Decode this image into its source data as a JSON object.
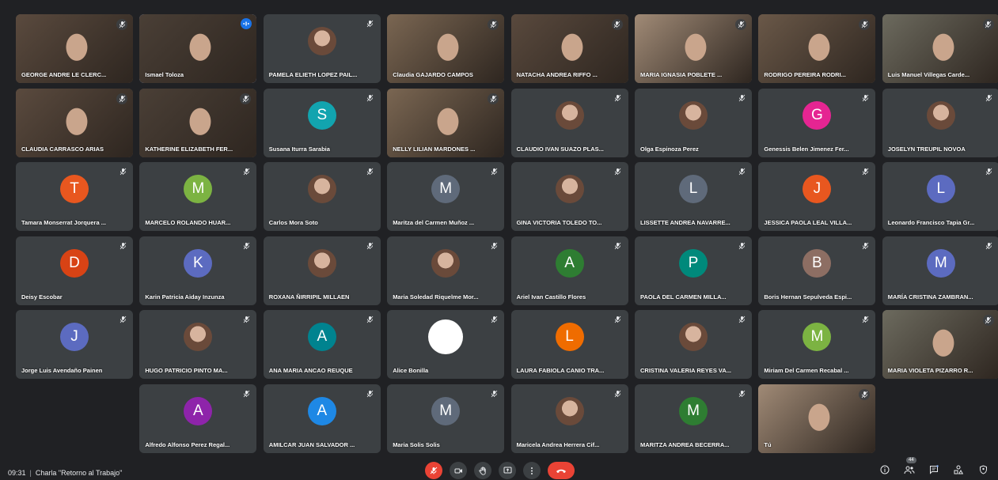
{
  "meeting": {
    "time": "09:31",
    "title": "Charla \"Retorno al Trabajo\"",
    "participant_count": "44"
  },
  "colors": {
    "background": "#202124",
    "tile": "#3c4043",
    "end_call": "#ea4335",
    "active_border": "#8ab4f8"
  },
  "tiles": [
    {
      "name": "GEORGE ANDRE LE CLERC...",
      "type": "video"
    },
    {
      "name": "Ismael Toloza",
      "type": "video",
      "speaking": true
    },
    {
      "name": "PAMELA ELIETH LOPEZ PAIL...",
      "type": "photo"
    },
    {
      "name": "Claudia GAJARDO CAMPOS",
      "type": "video"
    },
    {
      "name": "NATACHA ANDREA RIFFO ...",
      "type": "video"
    },
    {
      "name": "MARIA IGNASIA POBLETE ...",
      "type": "video"
    },
    {
      "name": "RODRIGO PEREIRA RODRI...",
      "type": "video"
    },
    {
      "name": "Luis Manuel Villegas Carde...",
      "type": "video"
    },
    {
      "name": "CLAUDIA CARRASCO ARIAS",
      "type": "video"
    },
    {
      "name": "KATHERINE ELIZABETH FER...",
      "type": "video"
    },
    {
      "name": "Susana Iturra Sarabia",
      "type": "letter",
      "letter": "S",
      "color": "#12a4af"
    },
    {
      "name": "NELLY LILIAN MARDONES ...",
      "type": "video"
    },
    {
      "name": "CLAUDIO IVAN SUAZO PLAS...",
      "type": "photo"
    },
    {
      "name": "Olga Espinoza Perez",
      "type": "photo"
    },
    {
      "name": "Genessis Belen Jimenez Fer...",
      "type": "letter",
      "letter": "G",
      "color": "#e52592"
    },
    {
      "name": "JOSELYN TREUPIL NOVOA",
      "type": "photo"
    },
    {
      "name": "Tamara Monserrat Jorquera ...",
      "type": "letter",
      "letter": "T",
      "color": "#e8571f"
    },
    {
      "name": "MARCELO ROLANDO HUAR...",
      "type": "letter",
      "letter": "M",
      "color": "#7cb342"
    },
    {
      "name": "Carlos Mora Soto",
      "type": "photo"
    },
    {
      "name": "Maritza del Carmen Muñoz ...",
      "type": "letter",
      "letter": "M",
      "color": "#5f6a7a"
    },
    {
      "name": "GINA VICTORIA TOLEDO TO...",
      "type": "photo"
    },
    {
      "name": "LISSETTE ANDREA NAVARRE...",
      "type": "letter",
      "letter": "L",
      "color": "#5f6a7a"
    },
    {
      "name": "JESSICA PAOLA LEAL VILLA...",
      "type": "letter",
      "letter": "J",
      "color": "#e8571f"
    },
    {
      "name": "Leonardo Francisco Tapia Gr...",
      "type": "letter",
      "letter": "L",
      "color": "#5c6bc0"
    },
    {
      "name": "Deisy Escobar",
      "type": "letter",
      "letter": "D",
      "color": "#d84315"
    },
    {
      "name": "Karin Patricia Aiday Inzunza",
      "type": "letter",
      "letter": "K",
      "color": "#5c6bc0"
    },
    {
      "name": "ROXANA ÑIRRIPIL MILLAEN",
      "type": "photo"
    },
    {
      "name": "Maria Soledad Riquelme Mor...",
      "type": "photo"
    },
    {
      "name": "Ariel Ivan Castillo Flores",
      "type": "letter",
      "letter": "A",
      "color": "#2e7d32"
    },
    {
      "name": "PAOLA DEL CARMEN MILLA...",
      "type": "letter",
      "letter": "P",
      "color": "#00897b"
    },
    {
      "name": "Boris Hernan Sepulveda Espi...",
      "type": "letter",
      "letter": "B",
      "color": "#8d6e63"
    },
    {
      "name": "MARÍA CRISTINA ZAMBRAN...",
      "type": "letter",
      "letter": "M",
      "color": "#5c6bc0"
    },
    {
      "name": "Jorge Luis Avendaño Painen",
      "type": "letter",
      "letter": "J",
      "color": "#5c6bc0"
    },
    {
      "name": "HUGO PATRICIO PINTO MA...",
      "type": "photo"
    },
    {
      "name": "ANA MARIA ANCAO REUQUE",
      "type": "letter",
      "letter": "A",
      "color": "#00838f"
    },
    {
      "name": "Alice Bonilla",
      "type": "white"
    },
    {
      "name": "LAURA FABIOLA CANIO TRA...",
      "type": "letter",
      "letter": "L",
      "color": "#ef6c00"
    },
    {
      "name": "CRISTINA VALERIA REYES VA...",
      "type": "photo"
    },
    {
      "name": "Miriam Del Carmen Recabal ...",
      "type": "letter",
      "letter": "M",
      "color": "#7cb342"
    },
    {
      "name": "MARIA VIOLETA PIZARRO R...",
      "type": "video"
    },
    {
      "name": "Alfredo Alfonso Perez Regal...",
      "type": "letter",
      "letter": "A",
      "color": "#8e24aa"
    },
    {
      "name": "AMILCAR JUAN SALVADOR ...",
      "type": "letter",
      "letter": "A",
      "color": "#1e88e5"
    },
    {
      "name": "Maria Solis Solis",
      "type": "letter",
      "letter": "M",
      "color": "#5f6a7a"
    },
    {
      "name": "Maricela Andrea Herrera Cif...",
      "type": "photo"
    },
    {
      "name": "MARITZA ANDREA BECERRA...",
      "type": "letter",
      "letter": "M",
      "color": "#2e7d32"
    },
    {
      "name": "Tú",
      "type": "video"
    }
  ]
}
